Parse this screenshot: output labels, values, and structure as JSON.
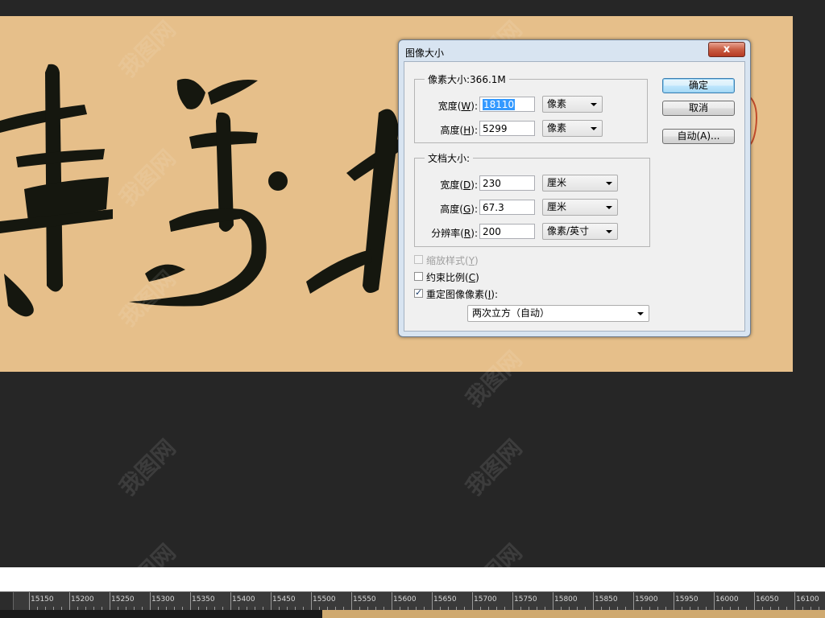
{
  "dialog": {
    "title": "图像大小",
    "close_label": "x",
    "pixel_dimensions": {
      "label": "像素大小:366.1M",
      "width_label": "宽度",
      "width_hotkey": "W",
      "width_value": "18110",
      "width_unit": "像素",
      "height_label": "高度",
      "height_hotkey": "H",
      "height_value": "5299",
      "height_unit": "像素"
    },
    "document_size": {
      "label": "文档大小:",
      "width_label": "宽度",
      "width_hotkey": "D",
      "width_value": "230",
      "width_unit": "厘米",
      "height_label": "高度",
      "height_hotkey": "G",
      "height_value": "67.3",
      "height_unit": "厘米",
      "resolution_label": "分辨率",
      "resolution_hotkey": "R",
      "resolution_value": "200",
      "resolution_unit": "像素/英寸"
    },
    "buttons": {
      "ok": "确定",
      "cancel": "取消",
      "auto": "自动(A)..."
    },
    "options": {
      "scale_styles": {
        "label": "缩放样式",
        "hotkey": "Y",
        "checked": false,
        "enabled": false
      },
      "constrain": {
        "label": "约束比例",
        "hotkey": "C",
        "checked": false,
        "enabled": true
      },
      "resample": {
        "label": "重定图像像素",
        "hotkey": "I",
        "checked": true,
        "enabled": true
      }
    },
    "resample_method": "两次立方（自动）",
    "colon": ":"
  },
  "ruler": {
    "labels": [
      "15150",
      "15200",
      "15250",
      "15300",
      "15350",
      "15400",
      "15450",
      "15500",
      "15550",
      "15600",
      "15650",
      "15700",
      "15750",
      "15800",
      "15850",
      "15900",
      "15950",
      "16000",
      "16050",
      "16100"
    ]
  },
  "colors": {
    "workspace": "#262626",
    "canvas": "#e6bf8a",
    "ink": "#15170f",
    "seal": "#c04a2a"
  }
}
